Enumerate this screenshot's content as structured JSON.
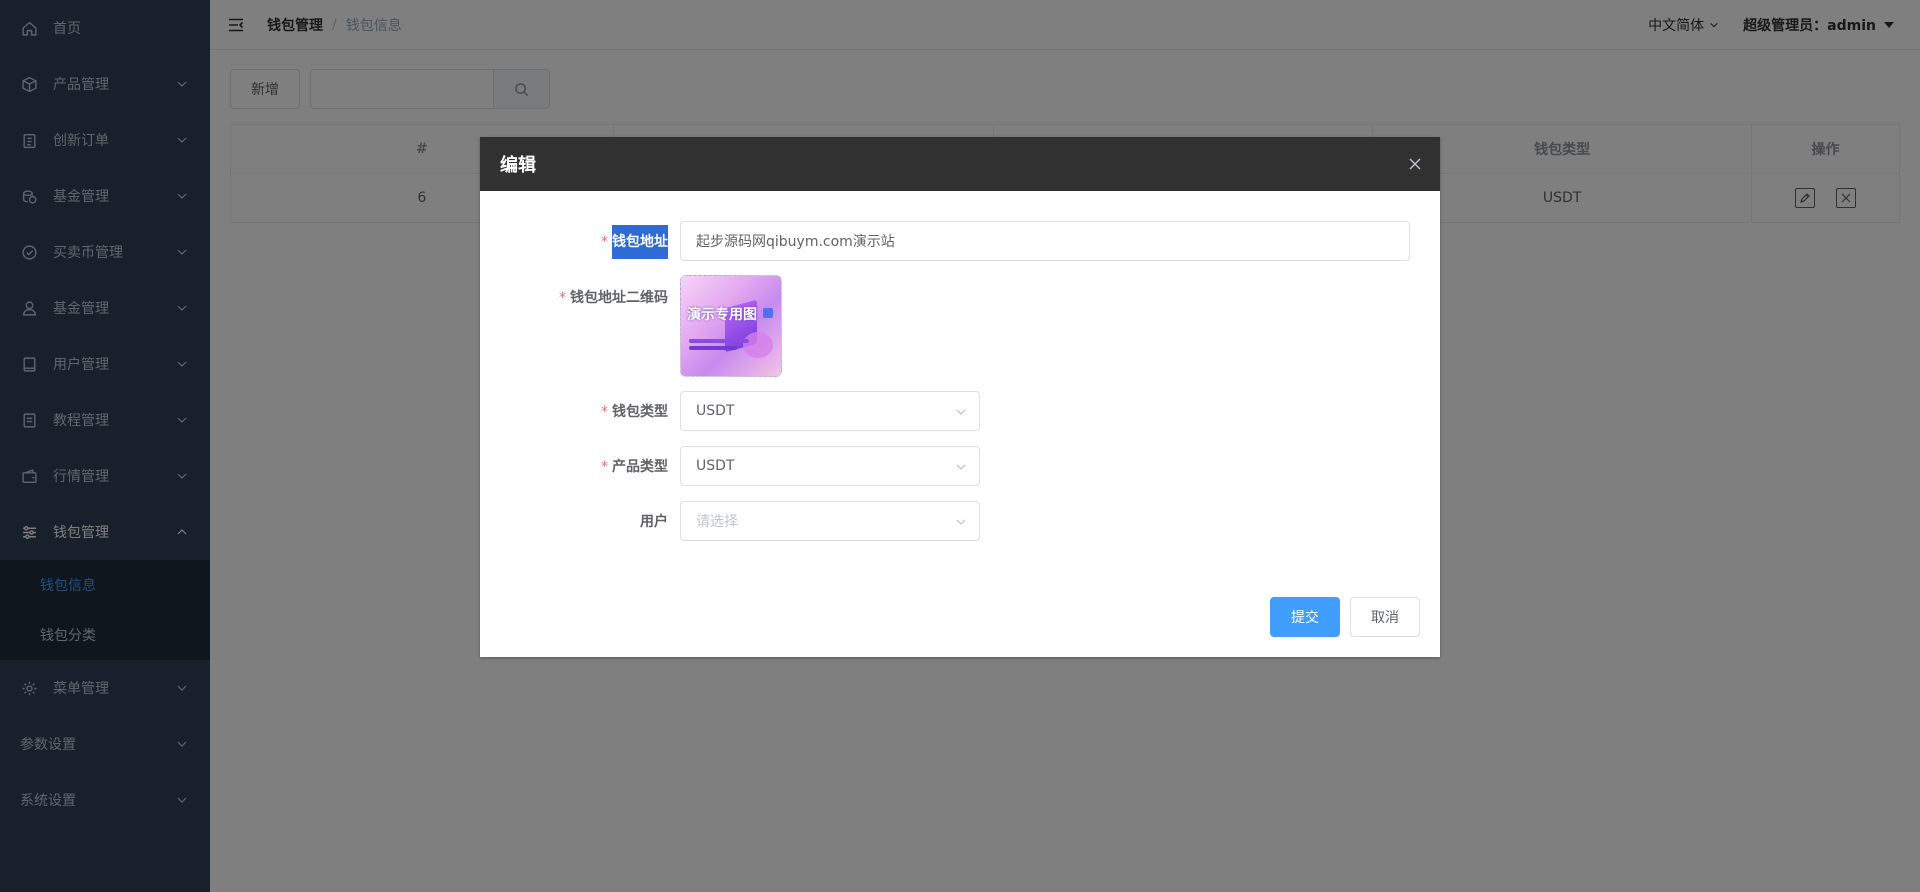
{
  "sidebar": {
    "items": [
      {
        "label": "首页",
        "icon": "home-icon"
      },
      {
        "label": "产品管理",
        "icon": "box-icon"
      },
      {
        "label": "创新订单",
        "icon": "clipboard-icon"
      },
      {
        "label": "基金管理",
        "icon": "coins-icon"
      },
      {
        "label": "买卖币管理",
        "icon": "check-circle-icon"
      },
      {
        "label": "基金管理",
        "icon": "user-icon"
      },
      {
        "label": "用户管理",
        "icon": "book-icon"
      },
      {
        "label": "教程管理",
        "icon": "document-icon"
      },
      {
        "label": "行情管理",
        "icon": "wallet-icon"
      },
      {
        "label": "钱包管理",
        "icon": "sliders-icon"
      },
      {
        "label": "菜单管理",
        "icon": "gear-icon"
      },
      {
        "label": "参数设置"
      },
      {
        "label": "系统设置"
      }
    ],
    "submenu": [
      {
        "label": "钱包信息"
      },
      {
        "label": "钱包分类"
      }
    ]
  },
  "navbar": {
    "breadcrumb": [
      "钱包管理",
      "钱包信息"
    ],
    "language": "中文简体",
    "user": "超级管理员：admin"
  },
  "toolbar": {
    "add_label": "新增",
    "search_value": ""
  },
  "table": {
    "headers": [
      "#",
      "",
      "",
      "钱包类型",
      "操作"
    ],
    "rows": [
      {
        "id": "6",
        "type": "USDT"
      }
    ]
  },
  "dialog": {
    "title": "编辑",
    "fields": {
      "address_label": "钱包地址",
      "address_value": "起步源码网qibuym.com演示站",
      "qrcode_label": "钱包地址二维码",
      "qrcode_image_text": "演示专用图",
      "wallet_type_label": "钱包类型",
      "wallet_type_value": "USDT",
      "product_type_label": "产品类型",
      "product_type_value": "USDT",
      "user_label": "用户",
      "user_placeholder": "请选择"
    },
    "submit_label": "提交",
    "cancel_label": "取消"
  },
  "colors": {
    "sidebar_bg": "#304156",
    "accent": "#409eff",
    "required": "#f56c6c",
    "dialog_header": "#313131"
  }
}
